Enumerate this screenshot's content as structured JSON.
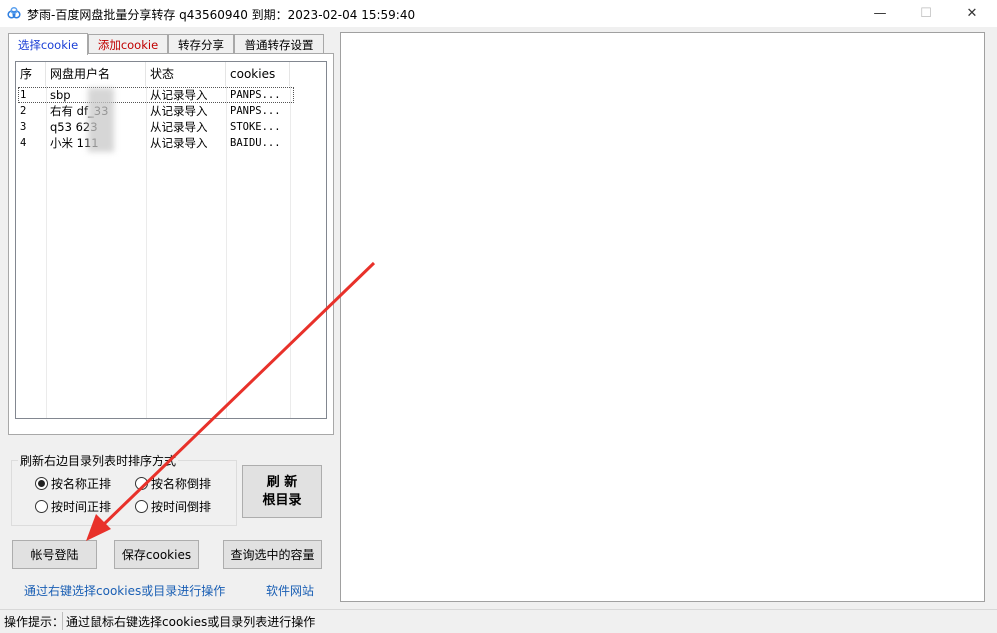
{
  "window": {
    "title": "梦雨-百度网盘批量分享转存 q43560940  到期：2023-02-04 15:59:40",
    "minimize": "—",
    "maximize": "☐",
    "close": "✕"
  },
  "tabs": [
    {
      "label": "选择cookie",
      "color": "#1a3fd6"
    },
    {
      "label": "添加cookie",
      "color": "#c00000"
    },
    {
      "label": "转存分享",
      "color": "#000000"
    },
    {
      "label": "普通转存设置",
      "color": "#000000"
    }
  ],
  "list": {
    "headers": [
      "序",
      "网盘用户名",
      "状态",
      "cookies"
    ],
    "rows": [
      [
        "1",
        "sbp",
        "从记录导入",
        "PANPS..."
      ],
      [
        "2",
        "右有    df_33",
        "从记录导入",
        "PANPS..."
      ],
      [
        "3",
        "q53     623",
        "从记录导入",
        "STOKE..."
      ],
      [
        "4",
        "小米    111",
        "从记录导入",
        "BAIDU..."
      ]
    ]
  },
  "sort_group": {
    "title": "刷新右边目录列表时排序方式",
    "options": [
      {
        "label": "按名称正排",
        "checked": true
      },
      {
        "label": "按名称倒排",
        "checked": false
      },
      {
        "label": "按时间正排",
        "checked": false
      },
      {
        "label": "按时间倒排",
        "checked": false
      }
    ]
  },
  "buttons": {
    "refresh_line1": "刷  新",
    "refresh_line2": "根目录",
    "login": "帐号登陆",
    "save_cookies": "保存cookies",
    "query_capacity": "查询选中的容量"
  },
  "links": {
    "hint": "通过右键选择cookies或目录进行操作",
    "website": "软件网站"
  },
  "status": {
    "label": "操作提示：",
    "text": "通过鼠标右键选择cookies或目录列表进行操作"
  },
  "colors": {
    "arrow": "#e8312a",
    "link": "#1a5fb4"
  }
}
